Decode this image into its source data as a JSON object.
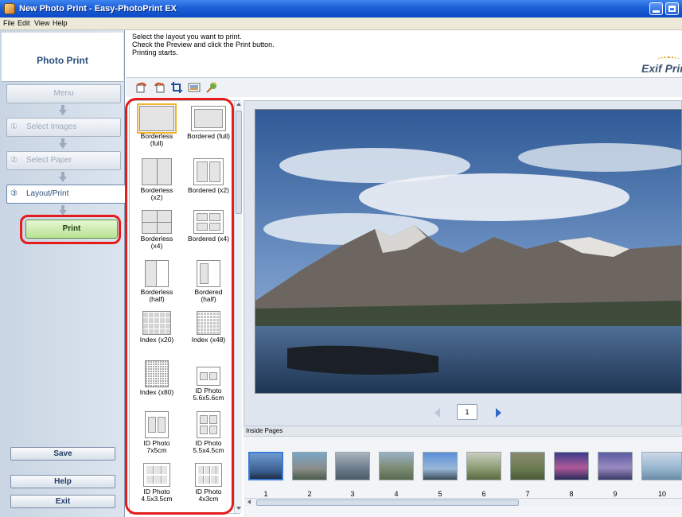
{
  "window": {
    "title": "New Photo Print - Easy-PhotoPrint EX"
  },
  "menu": {
    "items": [
      "File",
      "Edit",
      "View",
      "Help"
    ]
  },
  "sidebar": {
    "title": "Photo Print",
    "menu_label": "Menu",
    "steps": [
      {
        "num": "①",
        "label": "Select Images"
      },
      {
        "num": "②",
        "label": "Select Paper"
      },
      {
        "num": "③",
        "label": "Layout/Print"
      }
    ],
    "print_label": "Print",
    "save_label": "Save",
    "help_label": "Help",
    "exit_label": "Exit"
  },
  "instructions": "Select the layout you want to print.\nCheck the Preview and click the Print button.\nPrinting starts.",
  "brand_logo": "Exif Print",
  "toolbar": {
    "icons": [
      "rotate-left-icon",
      "rotate-right-icon",
      "crop-icon",
      "image-adjust-icon",
      "special-filter-icon"
    ]
  },
  "layouts": [
    {
      "label": "Borderless\n(full)",
      "selected": true
    },
    {
      "label": "Bordered (full)",
      "selected": false
    },
    {
      "label": "Borderless\n(x2)",
      "selected": false
    },
    {
      "label": "Bordered (x2)",
      "selected": false
    },
    {
      "label": "Borderless\n(x4)",
      "selected": false
    },
    {
      "label": "Bordered (x4)",
      "selected": false
    },
    {
      "label": "Borderless\n(half)",
      "selected": false
    },
    {
      "label": "Bordered\n(half)",
      "selected": false
    },
    {
      "label": "Index (x20)",
      "selected": false
    },
    {
      "label": "Index (x48)",
      "selected": false
    },
    {
      "label": "Index (x80)",
      "selected": false
    },
    {
      "label": "ID Photo\n5.6x5.6cm",
      "selected": false
    },
    {
      "label": "ID Photo\n7x5cm",
      "selected": false
    },
    {
      "label": "ID Photo\n5.5x4.5cm",
      "selected": false
    },
    {
      "label": "ID Photo\n4.5x3.5cm",
      "selected": false
    },
    {
      "label": "ID Photo\n4x3cm",
      "selected": false
    }
  ],
  "pager": {
    "current_page": "1"
  },
  "inside_pages": {
    "title": "Inside Pages",
    "pages": [
      "1",
      "2",
      "3",
      "4",
      "5",
      "6",
      "7",
      "8",
      "9",
      "10"
    ]
  },
  "colors": {
    "titlebar": "#1b5fd6",
    "highlight_ring": "#e51c1c",
    "selected_outline": "#f2b32e",
    "print_button": "#b9e292"
  }
}
